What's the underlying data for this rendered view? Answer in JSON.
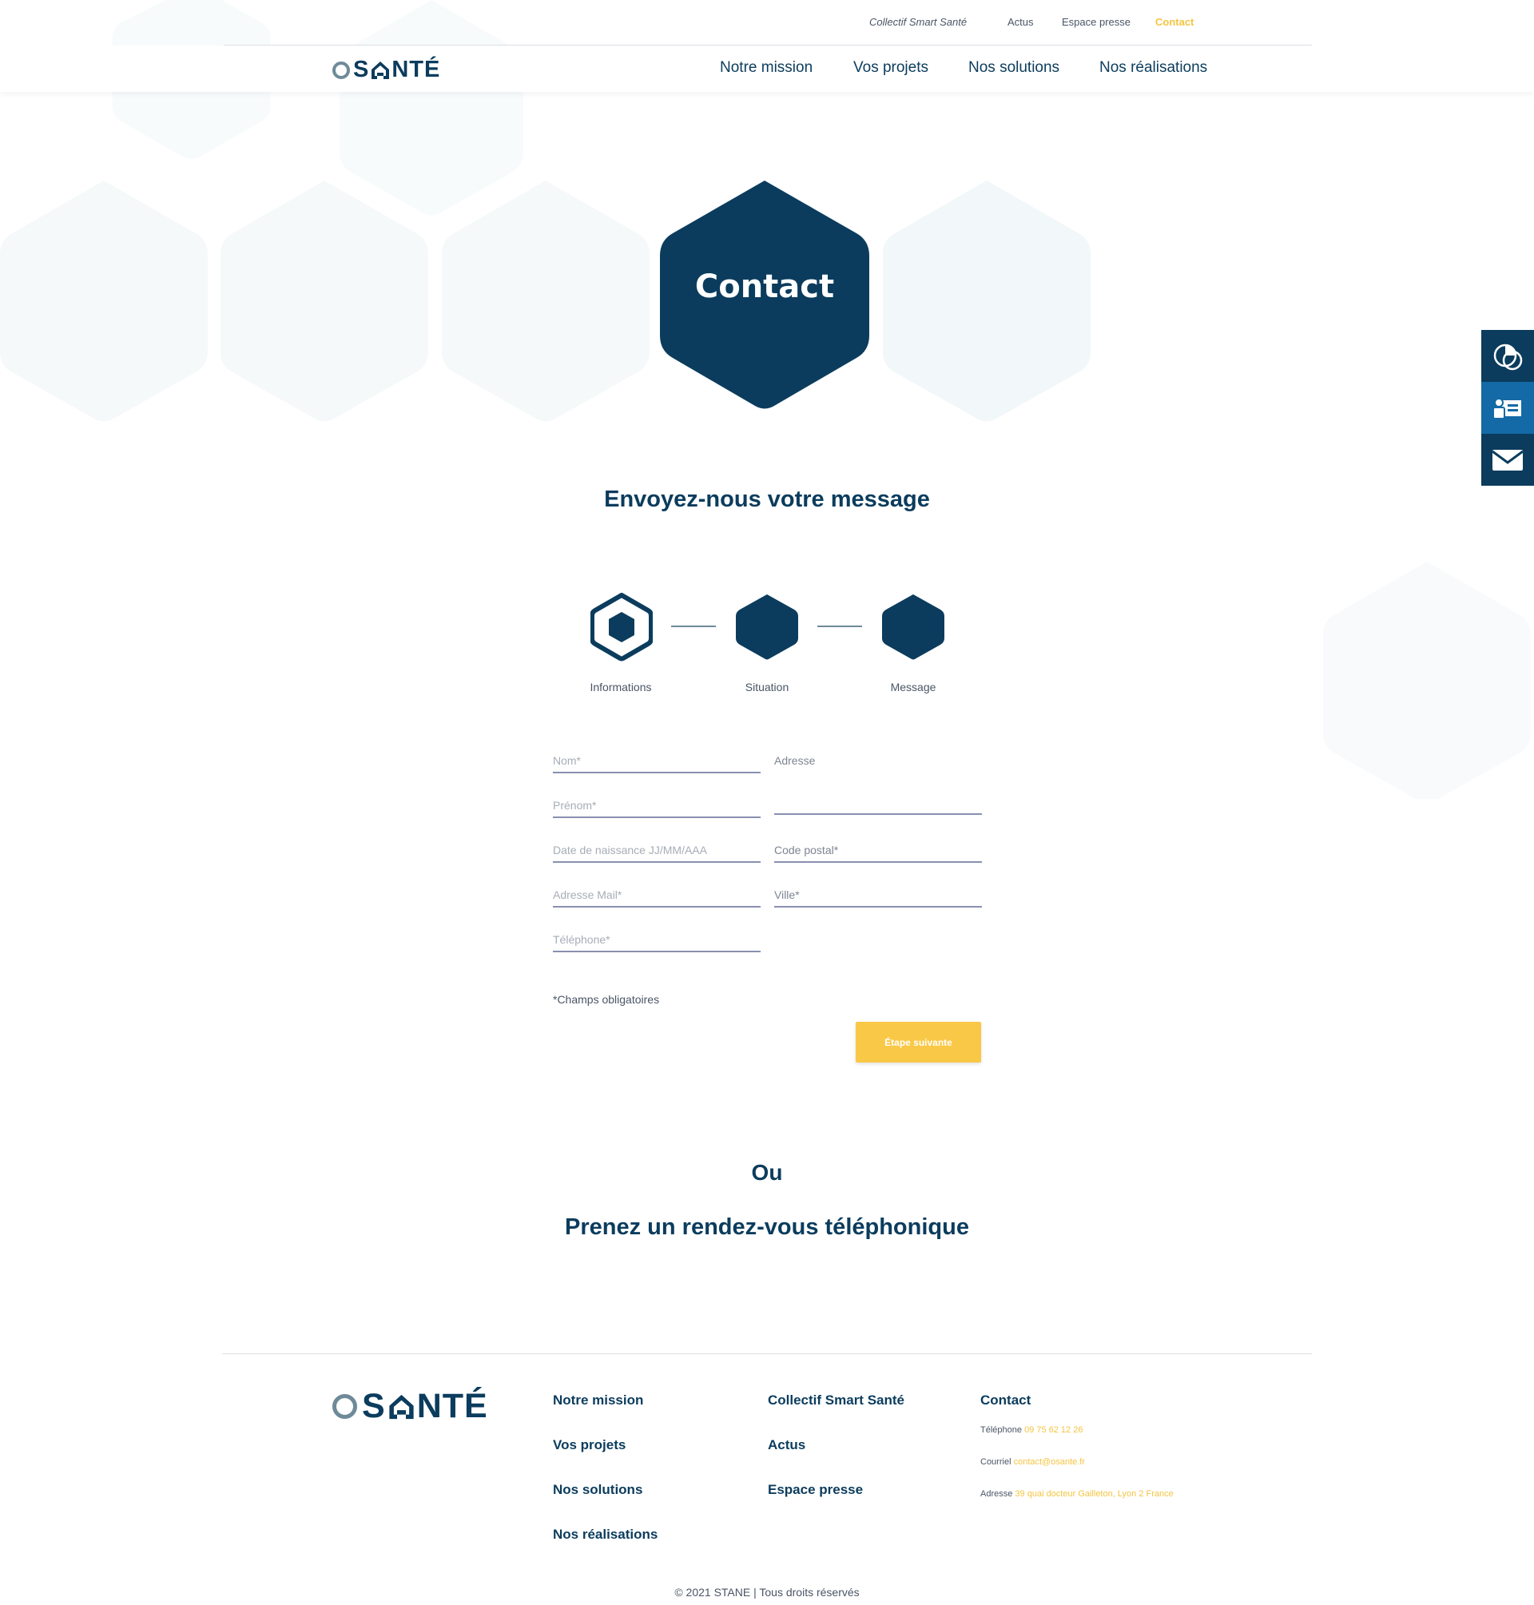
{
  "colors": {
    "brand_dark": "#0b3c5d",
    "brand_blue": "#136aa6",
    "accent_yellow": "#f9c846",
    "link_yellow": "#f4c442",
    "logo_grey": "#6f8a99",
    "field_underline": "#8a8fb0"
  },
  "topbar": {
    "collectif": "Collectif Smart Santé",
    "actus": "Actus",
    "presse": "Espace presse",
    "contact": "Contact"
  },
  "logo": {
    "s": "S",
    "nte": "NTÉ"
  },
  "nav": {
    "mission": "Notre mission",
    "projets": "Vos projets",
    "solutions": "Nos solutions",
    "realisations": "Nos réalisations"
  },
  "hero": {
    "title": "Contact"
  },
  "sidebar": {
    "icons": [
      "chart-circle-icon",
      "id-card-icon",
      "mail-icon"
    ]
  },
  "form_section": {
    "title": "Envoyez-nous votre message"
  },
  "stepper": {
    "steps": [
      {
        "label": "Informations",
        "state": "active"
      },
      {
        "label": "Situation",
        "state": "pending"
      },
      {
        "label": "Message",
        "state": "pending"
      }
    ]
  },
  "form": {
    "nom": "Nom*",
    "prenom": "Prénom*",
    "naissance": "Date de naissance JJ/MM/AAA",
    "mail": "Adresse Mail*",
    "telephone": "Téléphone*",
    "adresse": "Adresse",
    "code_postal": "Code postal*",
    "ville": "Ville*",
    "required_note": "*Champs obligatoires",
    "next_label": "Étape suivante"
  },
  "alt_section": {
    "or": "Ou",
    "title": "Prenez un rendez-vous téléphonique"
  },
  "footer": {
    "col1": [
      "Notre mission",
      "Vos projets",
      "Nos solutions",
      "Nos réalisations"
    ],
    "col2": [
      "Collectif Smart Santé",
      "Actus",
      "Espace presse"
    ],
    "contact_title": "Contact",
    "phone_label": "Téléphone",
    "phone": "09 75 62 12 26",
    "mail_label": "Courriel",
    "mail": "contact@osante.fr",
    "address_label": "Adresse",
    "address": "39 quai docteur Gailleton, Lyon 2 France",
    "copyright": "© 2021 STANE | Tous droits réservés"
  }
}
